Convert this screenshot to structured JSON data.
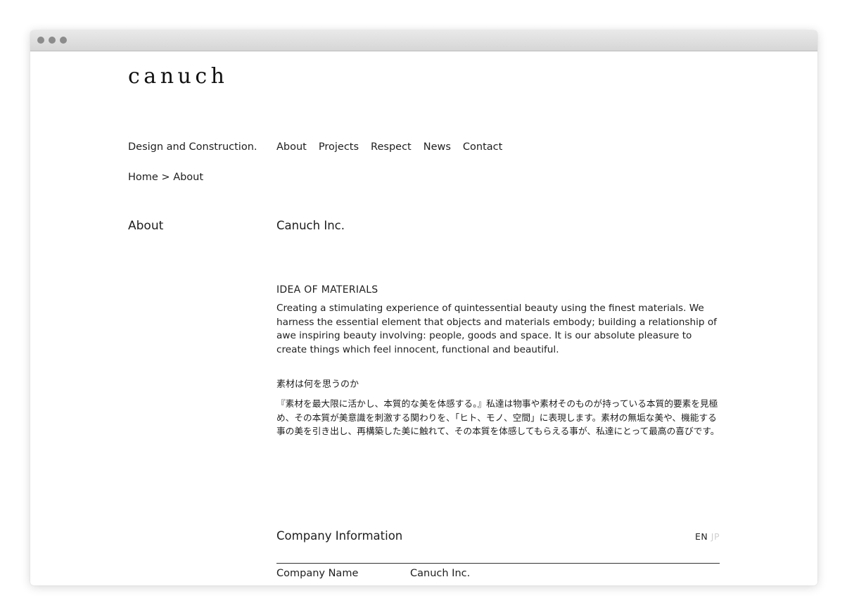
{
  "brand": {
    "logo": "canuch",
    "tagline": "Design and Construction."
  },
  "nav": {
    "items": [
      "About",
      "Projects",
      "Respect",
      "News",
      "Contact"
    ]
  },
  "breadcrumb": "Home > About",
  "sidebar": {
    "title": "About"
  },
  "main": {
    "heading": "Canuch Inc.",
    "idea": {
      "title": "IDEA OF MATERIALS",
      "body": "Creating a stimulating experience of quintessential beauty using the finest materials. We harness the essential element that objects and materials embody; building a relationship of awe inspiring beauty involving: people, goods and space. It is our absolute pleasure to create things which feel innocent, functional and beautiful."
    },
    "idea_jp": {
      "title": "素材は何を思うのか",
      "body": "『素材を最大限に活かし、本質的な美を体感する。』私達は物事や素材そのものが持っている本質的要素を見極め、その本質が美意識を刺激する関わりを、「ヒト、モノ、空間」に表現します。素材の無垢な美や、機能する事の美を引き出し、再構築した美に触れて、その本質を体感してもらえる事が、私達にとって最高の喜びです。"
    },
    "company_info": {
      "title": "Company Information",
      "lang_active": "EN",
      "lang_inactive": "JP",
      "rows": [
        {
          "label": "Company Name",
          "value": "Canuch Inc."
        }
      ]
    }
  },
  "colors": {
    "text": "#1e1e1e",
    "lang_inactive": "#cfcfcf"
  }
}
